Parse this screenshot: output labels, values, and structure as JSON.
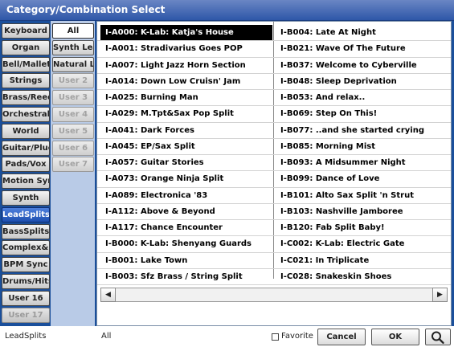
{
  "window": {
    "title": "Category/Combination Select"
  },
  "categories": [
    {
      "label": "Keyboard",
      "state": "normal"
    },
    {
      "label": "Organ",
      "state": "normal"
    },
    {
      "label": "Bell/Mallet",
      "state": "normal"
    },
    {
      "label": "Strings",
      "state": "normal"
    },
    {
      "label": "Brass/Reed",
      "state": "normal"
    },
    {
      "label": "Orchestral",
      "state": "normal"
    },
    {
      "label": "World",
      "state": "normal"
    },
    {
      "label": "Guitar/Pluck",
      "state": "normal"
    },
    {
      "label": "Pads/Vox",
      "state": "normal"
    },
    {
      "label": "Motion Synth",
      "state": "normal"
    },
    {
      "label": "Synth",
      "state": "normal"
    },
    {
      "label": "LeadSplits",
      "state": "selected"
    },
    {
      "label": "BassSplits",
      "state": "normal"
    },
    {
      "label": "Complex&Fx",
      "state": "normal"
    },
    {
      "label": "BPM Sync",
      "state": "normal"
    },
    {
      "label": "Drums/Hits",
      "state": "normal"
    },
    {
      "label": "User 16",
      "state": "normal"
    },
    {
      "label": "User 17",
      "state": "disabled"
    }
  ],
  "subcategories": [
    {
      "label": "All",
      "state": "selected"
    },
    {
      "label": "Synth Lead",
      "state": "normal"
    },
    {
      "label": "Natural Lead",
      "state": "normal"
    },
    {
      "label": "User 2",
      "state": "disabled"
    },
    {
      "label": "User 3",
      "state": "disabled"
    },
    {
      "label": "User 4",
      "state": "disabled"
    },
    {
      "label": "User 5",
      "state": "disabled"
    },
    {
      "label": "User 6",
      "state": "disabled"
    },
    {
      "label": "User 7",
      "state": "disabled"
    }
  ],
  "list": {
    "left_column": [
      "I-A000: K-Lab: Katja's House",
      "I-A001: Stradivarius Goes POP",
      "I-A007: Light Jazz Horn Section",
      "I-A014: Down Low Cruisn' Jam",
      "I-A025: Burning Man",
      "I-A029: M.Tpt&Sax Pop Split",
      "I-A041: Dark Forces",
      "I-A045: EP/Sax Split",
      "I-A057: Guitar Stories",
      "I-A073: Orange Ninja Split",
      "I-A089: Electronica '83",
      "I-A112: Above & Beyond",
      "I-A117: Chance Encounter",
      "I-B000: K-Lab: Shenyang Guards",
      "I-B001: Lake Town",
      "I-B003: Sfz Brass / String Split"
    ],
    "right_column": [
      "I-B004: Late At Night",
      "I-B021: Wave Of The Future",
      "I-B037: Welcome to Cyberville",
      "I-B048: Sleep Deprivation",
      "I-B053: And relax..",
      "I-B069: Step On This!",
      "I-B077: ..and she started crying",
      "I-B085: Morning Mist",
      "I-B093: A Midsummer Night",
      "I-B099: Dance of Love",
      "I-B101: Alto Sax Split 'n Strut",
      "I-B103: Nashville Jamboree",
      "I-B120: Fab Split Baby!",
      "I-C002: K-Lab: Electric Gate",
      "I-C021: In Triplicate",
      "I-C028: Snakeskin Shoes"
    ],
    "selected": "I-A000: K-Lab: Katja's House"
  },
  "scrollbar": {
    "left_arrow": "◀",
    "right_arrow": "▶"
  },
  "bottom": {
    "category_name": "LeadSplits",
    "subcategory_name": "All",
    "favorite_label": "Favorite",
    "favorite_checked": false,
    "cancel_label": "Cancel",
    "ok_label": "OK",
    "search_icon": "magnifier-icon"
  }
}
